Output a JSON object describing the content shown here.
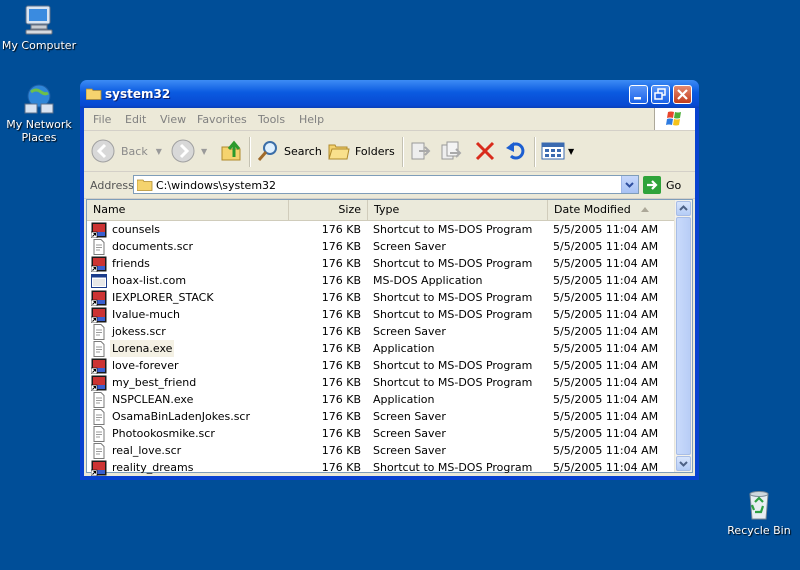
{
  "desktop": {
    "icons": [
      {
        "label": "My Computer",
        "icon": "my-computer-icon"
      },
      {
        "label": "My Network Places",
        "icon": "network-places-icon"
      },
      {
        "label": "Recycle Bin",
        "icon": "recycle-bin-icon"
      }
    ],
    "background_color": "#004e98"
  },
  "window": {
    "title": "system32",
    "menu": [
      "File",
      "Edit",
      "View",
      "Favorites",
      "Tools",
      "Help"
    ],
    "toolbar": {
      "back_label": "Back",
      "search_label": "Search",
      "folders_label": "Folders"
    },
    "address": {
      "label": "Address",
      "value": "C:\\windows\\system32",
      "go_label": "Go"
    },
    "columns": {
      "name": "Name",
      "size": "Size",
      "type": "Type",
      "date": "Date Modified"
    },
    "files": [
      {
        "name": "counsels",
        "size": "176 KB",
        "type": "Shortcut to MS-DOS Program",
        "date": "5/5/2005 11:04 AM",
        "icon": "msdos-shortcut-icon"
      },
      {
        "name": "documents.scr",
        "size": "176 KB",
        "type": "Screen Saver",
        "date": "5/5/2005 11:04 AM",
        "icon": "screensaver-file-icon"
      },
      {
        "name": "friends",
        "size": "176 KB",
        "type": "Shortcut to MS-DOS Program",
        "date": "5/5/2005 11:04 AM",
        "icon": "msdos-shortcut-icon"
      },
      {
        "name": "hoax-list.com",
        "size": "176 KB",
        "type": "MS-DOS Application",
        "date": "5/5/2005 11:04 AM",
        "icon": "msdos-app-icon"
      },
      {
        "name": "IEXPLORER_STACK",
        "size": "176 KB",
        "type": "Shortcut to MS-DOS Program",
        "date": "5/5/2005 11:04 AM",
        "icon": "msdos-shortcut-icon"
      },
      {
        "name": "Ivalue-much",
        "size": "176 KB",
        "type": "Shortcut to MS-DOS Program",
        "date": "5/5/2005 11:04 AM",
        "icon": "msdos-shortcut-icon"
      },
      {
        "name": "jokess.scr",
        "size": "176 KB",
        "type": "Screen Saver",
        "date": "5/5/2005 11:04 AM",
        "icon": "screensaver-file-icon"
      },
      {
        "name": "Lorena.exe",
        "size": "176 KB",
        "type": "Application",
        "date": "5/5/2005 11:04 AM",
        "icon": "application-file-icon"
      },
      {
        "name": "love-forever",
        "size": "176 KB",
        "type": "Shortcut to MS-DOS Program",
        "date": "5/5/2005 11:04 AM",
        "icon": "msdos-shortcut-icon"
      },
      {
        "name": "my_best_friend",
        "size": "176 KB",
        "type": "Shortcut to MS-DOS Program",
        "date": "5/5/2005 11:04 AM",
        "icon": "msdos-shortcut-icon"
      },
      {
        "name": "NSPCLEAN.exe",
        "size": "176 KB",
        "type": "Application",
        "date": "5/5/2005 11:04 AM",
        "icon": "application-file-icon"
      },
      {
        "name": "OsamaBinLadenJokes.scr",
        "size": "176 KB",
        "type": "Screen Saver",
        "date": "5/5/2005 11:04 AM",
        "icon": "screensaver-file-icon"
      },
      {
        "name": "Photookosmike.scr",
        "size": "176 KB",
        "type": "Screen Saver",
        "date": "5/5/2005 11:04 AM",
        "icon": "screensaver-file-icon"
      },
      {
        "name": "real_love.scr",
        "size": "176 KB",
        "type": "Screen Saver",
        "date": "5/5/2005 11:04 AM",
        "icon": "screensaver-file-icon"
      },
      {
        "name": "reality_dreams",
        "size": "176 KB",
        "type": "Shortcut to MS-DOS Program",
        "date": "5/5/2005 11:04 AM",
        "icon": "msdos-shortcut-icon"
      }
    ]
  }
}
